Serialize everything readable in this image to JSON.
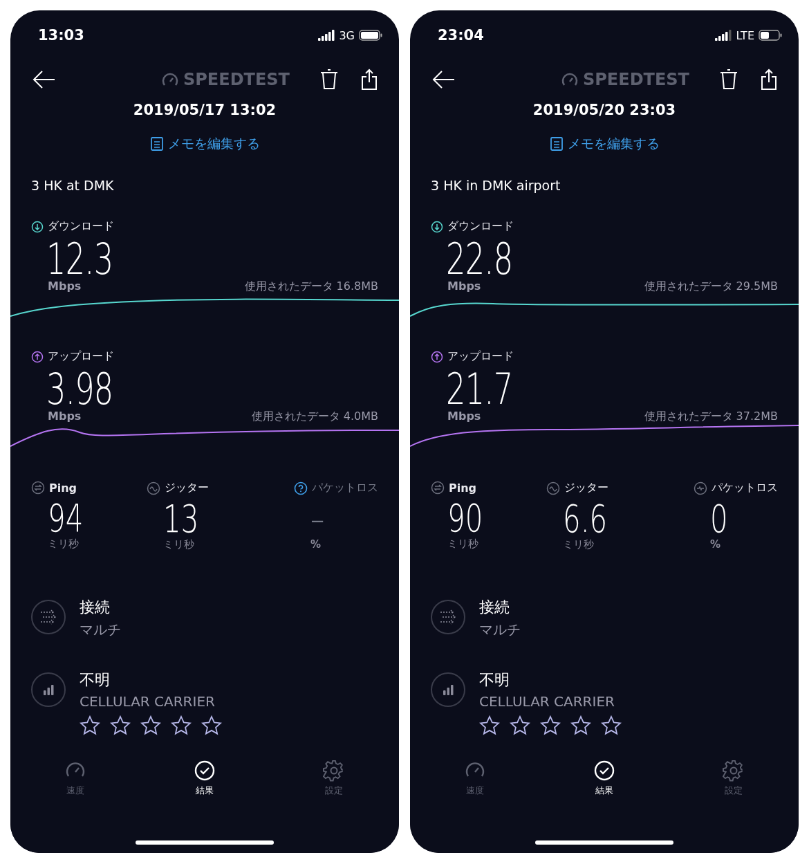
{
  "phones": [
    {
      "status_bar": {
        "time": "13:03",
        "network": "3G"
      },
      "header": {
        "logo": "SPEEDTEST",
        "date": "2019/05/17 13:02",
        "memo_link": "メモを編集する"
      },
      "note": "3 HK at DMK",
      "speeds": [
        {
          "kind": "download",
          "label": "ダウンロード",
          "value": "12.3",
          "unit": "Mbps",
          "data_used": "使用されたデータ 16.8MB"
        },
        {
          "kind": "upload",
          "label": "アップロード",
          "value": "3.98",
          "unit": "Mbps",
          "data_used": "使用されたデータ 4.0MB"
        }
      ],
      "metrics": [
        {
          "kind": "ping",
          "label": "Ping",
          "value": "94",
          "unit": "ミリ秒"
        },
        {
          "kind": "jitter",
          "label": "ジッター",
          "value": "13",
          "unit": "ミリ秒"
        },
        {
          "kind": "unknown",
          "label": "パケットロス",
          "value": "–",
          "unit": "%"
        }
      ],
      "details": [
        {
          "kind": "connection",
          "title": "接続",
          "subtitle": "マルチ"
        },
        {
          "kind": "carrier",
          "title": "不明",
          "subtitle": "CELLULAR CARRIER",
          "stars": 0
        }
      ],
      "tabs": [
        {
          "kind": "speed",
          "label": "速度",
          "selected": false
        },
        {
          "kind": "results",
          "label": "結果",
          "selected": true
        },
        {
          "kind": "settings",
          "label": "設定",
          "selected": false
        }
      ]
    },
    {
      "status_bar": {
        "time": "23:04",
        "network": "LTE"
      },
      "header": {
        "logo": "SPEEDTEST",
        "date": "2019/05/20 23:03",
        "memo_link": "メモを編集する"
      },
      "note": "3 HK in DMK airport",
      "speeds": [
        {
          "kind": "download",
          "label": "ダウンロード",
          "value": "22.8",
          "unit": "Mbps",
          "data_used": "使用されたデータ 29.5MB"
        },
        {
          "kind": "upload",
          "label": "アップロード",
          "value": "21.7",
          "unit": "Mbps",
          "data_used": "使用されたデータ 37.2MB"
        }
      ],
      "metrics": [
        {
          "kind": "ping",
          "label": "Ping",
          "value": "90",
          "unit": "ミリ秒"
        },
        {
          "kind": "jitter",
          "label": "ジッター",
          "value": "6.6",
          "unit": "ミリ秒"
        },
        {
          "kind": "packet_loss",
          "label": "パケットロス",
          "value": "0",
          "unit": "%"
        }
      ],
      "details": [
        {
          "kind": "connection",
          "title": "接続",
          "subtitle": "マルチ"
        },
        {
          "kind": "carrier",
          "title": "不明",
          "subtitle": "CELLULAR CARRIER",
          "stars": 0
        }
      ],
      "tabs": [
        {
          "kind": "speed",
          "label": "速度",
          "selected": false
        },
        {
          "kind": "results",
          "label": "結果",
          "selected": true
        },
        {
          "kind": "settings",
          "label": "設定",
          "selected": false
        }
      ]
    }
  ]
}
